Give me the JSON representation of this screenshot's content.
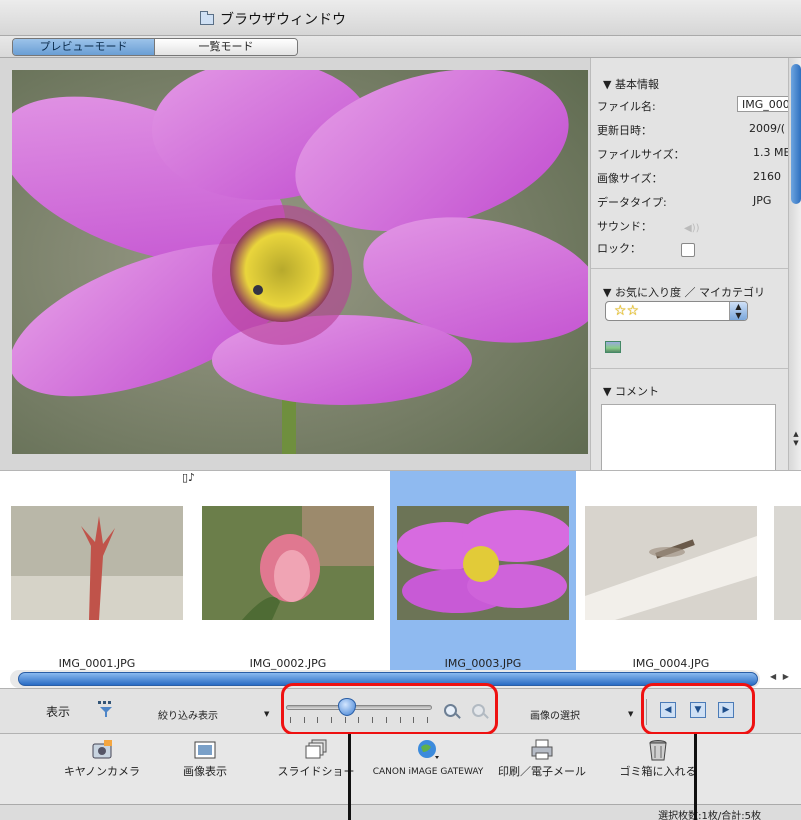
{
  "window": {
    "title": "ブラウザウィンドウ"
  },
  "modes": {
    "preview": "プレビューモード",
    "list": "一覧モード"
  },
  "info": {
    "basic_header": "▼ 基本情報",
    "rows": [
      {
        "label": "ファイル名:",
        "value": "IMG_000"
      },
      {
        "label": "更新日時：",
        "value": "2009/("
      },
      {
        "label": "ファイルサイズ：",
        "value": "1.3 ME"
      },
      {
        "label": "画像サイズ：",
        "value": "2160"
      },
      {
        "label": "データタイプ:",
        "value": "JPG"
      }
    ],
    "sound_label": "サウンド：",
    "lock_label": "ロック：",
    "fav_header": "▼ お気に入り度 ／ マイカテゴリ",
    "fav_stars": "☆☆",
    "comment_header": "▼ コメント"
  },
  "thumbnails": [
    {
      "label": "IMG_0001.JPG",
      "selected": false,
      "sound": true
    },
    {
      "label": "IMG_0002.JPG",
      "selected": false,
      "sound": false
    },
    {
      "label": "IMG_0003.JPG",
      "selected": true,
      "sound": false
    },
    {
      "label": "IMG_0004.JPG",
      "selected": false,
      "sound": false
    }
  ],
  "toolbar": {
    "view_label": "表示",
    "filter_label": "絞り込み表示",
    "image_select_label": "画像の選択"
  },
  "actions": [
    {
      "label": "キヤノンカメラ",
      "icon": "camera-icon"
    },
    {
      "label": "画像表示",
      "icon": "image-view-icon"
    },
    {
      "label": "スライドショー",
      "icon": "slideshow-icon"
    },
    {
      "label": "CANON iMAGE GATEWAY",
      "icon": "globe-icon"
    },
    {
      "label": "印刷／電子メール",
      "icon": "printer-icon"
    },
    {
      "label": "ゴミ箱に入れる",
      "icon": "trash-icon"
    }
  ],
  "status": {
    "text": "選択枚数:1枚/合計:5枚"
  },
  "colors": {
    "selection": "#8fbaf0",
    "highlight": "#ee1111",
    "accent": "#2a6cc4"
  }
}
